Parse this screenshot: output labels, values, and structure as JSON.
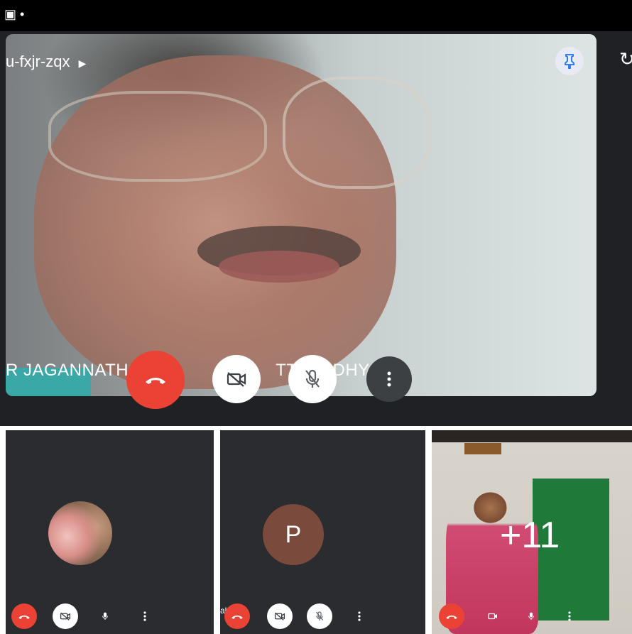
{
  "status_bar": {
    "left_icons": "▣ •"
  },
  "main_tile": {
    "meeting_code": "u-fxjr-zqx",
    "speaker_name": "R JAGANNATH",
    "speaker_name_hidden": "TTOPADHYAY",
    "controls": {
      "end_call": "end-call",
      "camera": "camera-off",
      "microphone": "mic-off",
      "more": "more"
    }
  },
  "tiles": [
    {
      "avatar": "photo"
    },
    {
      "avatar_initial": "P",
      "name_fragment": "al"
    },
    {
      "overflow_count": "+11"
    }
  ],
  "colors": {
    "end_call_red": "#ea4335",
    "background": "#202124",
    "control_dark": "#3c4043",
    "avatar_p": "#7a4a3c"
  }
}
